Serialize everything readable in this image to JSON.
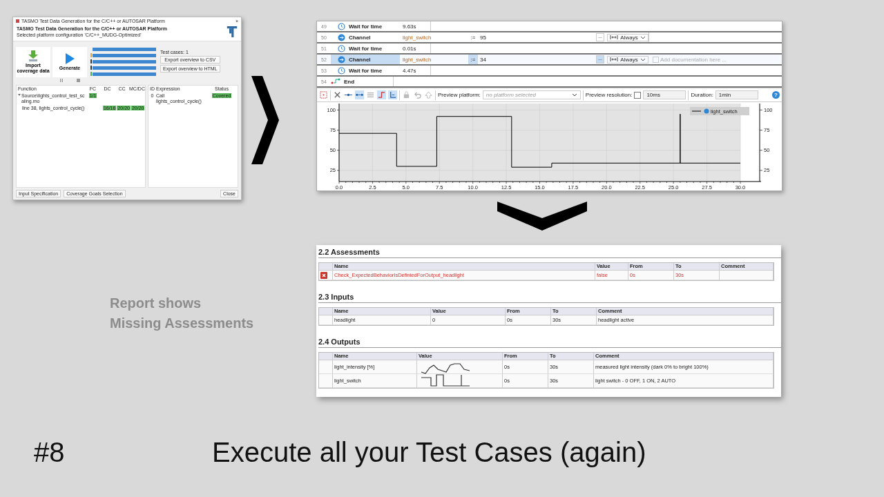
{
  "slide": {
    "note_lines": [
      "Report shows",
      "Missing Assessments"
    ],
    "number": "#8",
    "title": "Execute all your Test Cases (again)"
  },
  "generator": {
    "title": "TASMO Test Data Generation for the C/C++ or AUTOSAR Platform",
    "close": "×",
    "heading": "TASMO Test Data Generation for the C/C++ or AUTOSAR Platform",
    "subtitle": "Selected platform configuration 'C/C++_MUDG-Optimized'",
    "import_label": "Import coverage data",
    "generate_label": "Generate",
    "bars": [
      {
        "level": 1
      },
      {
        "level": 1,
        "color": "#e8a33c"
      },
      {
        "level": 1,
        "color": "#333333"
      },
      {
        "level": 1,
        "color": "#333333"
      },
      {
        "level": 1,
        "color": "#4caf50"
      }
    ],
    "test_cases": "Test cases: 1",
    "export_buttons": [
      "Export overview to CSV",
      "Export overview to HTML"
    ],
    "function_columns": [
      "Function",
      "FC",
      "DC",
      "CC",
      "MC/DC"
    ],
    "function_rows": [
      {
        "cells": [
          "Source\\lights_control_test_scaling.mo",
          "1/1",
          "",
          "",
          ""
        ],
        "expanded": true,
        "children": [
          {
            "cells": [
              "line 38, lights_control_cycle()",
              "",
              "16/16",
              "20/20",
              "20/20"
            ]
          }
        ]
      }
    ],
    "case_columns": [
      "ID",
      "Expression",
      "Status"
    ],
    "case_rows": [
      {
        "id": "0",
        "expression": "Call lights_control_cycle()",
        "status": "Covered"
      }
    ],
    "footer_buttons": [
      "Input Specification",
      "Coverage Goals Selection"
    ],
    "close_button": "Close"
  },
  "editor": {
    "rows": [
      {
        "line": "49",
        "kind": "wait",
        "label": "Wait for time",
        "value": "9.63s",
        "selected": false
      },
      {
        "line": "50",
        "kind": "channel",
        "label": "Channel",
        "signal": "light_switch",
        "op": ":=",
        "value": "95",
        "more": "...",
        "mode": "Always",
        "selected": false
      },
      {
        "line": "51",
        "kind": "wait",
        "label": "Wait for time",
        "value": "0.01s",
        "selected": false
      },
      {
        "line": "52",
        "kind": "channel",
        "label": "Channel",
        "signal": "light_switch",
        "op": ":=",
        "value": "34",
        "more": "...",
        "mode": "Always",
        "doc_placeholder": "Add documentation here ...",
        "selected": true
      },
      {
        "line": "53",
        "kind": "wait",
        "label": "Wait for time",
        "value": "4.47s",
        "selected": false
      },
      {
        "line": "54",
        "kind": "end",
        "label": "End",
        "selected": false
      }
    ],
    "tools": [
      {
        "kind": "grid",
        "on": false
      },
      {
        "kind": "cut",
        "on": false
      },
      {
        "kind": "line",
        "on": false
      },
      {
        "kind": "line-dots",
        "on": true
      },
      {
        "kind": "list",
        "on": false
      },
      {
        "kind": "step",
        "on": true
      },
      {
        "kind": "step-alt",
        "on": true
      },
      {
        "kind": "lock",
        "on": false
      },
      {
        "kind": "undo",
        "on": false
      },
      {
        "kind": "up",
        "on": false
      }
    ],
    "platform_label": "Preview platform:",
    "platform_placeholder": "no platform selected",
    "resolution_label": "Preview resolution:",
    "resolution_checked": false,
    "resolution": "10ms",
    "duration_label": "Duration:",
    "duration": "1min",
    "help": "?",
    "chart_data": {
      "type": "line",
      "grid": true,
      "xlim": [
        0,
        30
      ],
      "ylim": [
        12,
        108
      ],
      "xticks": [
        {
          "value": 0,
          "label": "0.0"
        },
        {
          "value": 2.5,
          "label": "2.5"
        },
        {
          "value": 5,
          "label": "5.0"
        },
        {
          "value": 7.5,
          "label": "7.5"
        },
        {
          "value": 10,
          "label": "10.0"
        },
        {
          "value": 12.5,
          "label": "12.5"
        },
        {
          "value": 15,
          "label": "15.0"
        },
        {
          "value": 17.5,
          "label": "17.5"
        },
        {
          "value": 20,
          "label": "20.0"
        },
        {
          "value": 22.5,
          "label": "22.5"
        },
        {
          "value": 25,
          "label": "25.0"
        },
        {
          "value": 27.5,
          "label": "27.5"
        },
        {
          "value": 30,
          "label": "30.0"
        }
      ],
      "yticks": [
        25,
        50,
        75,
        100
      ],
      "y2ticks": [
        25,
        50,
        75,
        100
      ],
      "y2lim": [
        12,
        108
      ],
      "x": [
        0,
        4.3,
        4.3,
        7.3,
        7.3,
        12.9,
        12.9,
        15.9,
        15.9,
        25.5,
        25.5,
        25.5,
        30
      ],
      "series": [
        {
          "name": "light_switch",
          "color": "#000000",
          "values": [
            71,
            71,
            30,
            30,
            92,
            92,
            29,
            29,
            34,
            34,
            95,
            34,
            34
          ]
        }
      ]
    }
  },
  "report": {
    "sections": [
      {
        "heading": "2.2 Assessments",
        "columns": [
          "Name",
          "Value",
          "From",
          "To",
          "Comment"
        ],
        "rows": [
          {
            "failed": true,
            "cells": [
              "Check_ExpectedBehaviorIsDefiniedForOutput_headlight",
              "false",
              "0s",
              "30s",
              ""
            ]
          }
        ]
      },
      {
        "heading": "2.3 Inputs",
        "columns": [
          "Name",
          "Value",
          "From",
          "To",
          "Comment"
        ],
        "rows": [
          {
            "failed": false,
            "cells": [
              "headlight",
              "0",
              "0s",
              "30s",
              "headlight active"
            ]
          }
        ]
      },
      {
        "heading": "2.4 Outputs",
        "columns": [
          "Name",
          "Value",
          "From",
          "To",
          "Comment"
        ],
        "rows": [
          {
            "failed": false,
            "cells": [
              "light_intensity [%]",
              {
                "kind": "sparkline"
              },
              "0s",
              "30s",
              "measured light intensity (dark 0% to bright 100%)"
            ]
          },
          {
            "failed": false,
            "cells": [
              "light_switch",
              {
                "kind": "sparkline"
              },
              "0s",
              "30s",
              "light switch - 0 OFF, 1 ON, 2 AUTO"
            ]
          }
        ]
      }
    ]
  }
}
